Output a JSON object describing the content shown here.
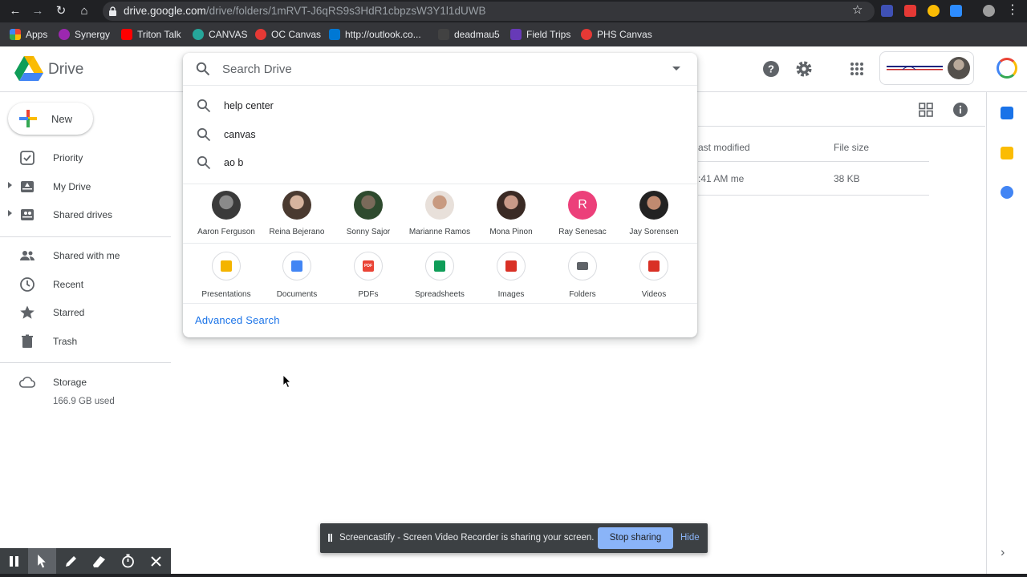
{
  "browser": {
    "url_host": "drive.google.com",
    "url_path": "/drive/folders/1mRVT-J6qRS9s3HdR1cbpzsW3Y1l1dUWB",
    "bookmarks": [
      {
        "label": "Apps",
        "color": "#ea4335"
      },
      {
        "label": "Synergy",
        "color": "#9c27b0"
      },
      {
        "label": "Triton Talk",
        "color": "#ff0000"
      },
      {
        "label": "CANVAS",
        "color": "#26a69a"
      },
      {
        "label": "OC Canvas",
        "color": "#e53935"
      },
      {
        "label": "http://outlook.co...",
        "color": "#0078d4"
      },
      {
        "label": "deadmau5",
        "color": "#424242"
      },
      {
        "label": "Field Trips",
        "color": "#673ab7"
      },
      {
        "label": "PHS Canvas",
        "color": "#e53935"
      }
    ]
  },
  "drive": {
    "title": "Drive",
    "new_label": "New",
    "nav": [
      {
        "label": "Priority"
      },
      {
        "label": "My Drive"
      },
      {
        "label": "Shared drives"
      },
      {
        "label": "Shared with me"
      },
      {
        "label": "Recent"
      },
      {
        "label": "Starred"
      },
      {
        "label": "Trash"
      }
    ],
    "storage_label": "Storage",
    "storage_used": "166.9 GB used"
  },
  "search": {
    "placeholder": "Search Drive",
    "suggestions": [
      "help center",
      "canvas",
      "ao b"
    ],
    "people": [
      {
        "name": "Aaron Ferguson"
      },
      {
        "name": "Reina Bejerano"
      },
      {
        "name": "Sonny Sajor"
      },
      {
        "name": "Marianne Ramos"
      },
      {
        "name": "Mona Pinon"
      },
      {
        "name": "Ray Senesac",
        "initial": "R"
      },
      {
        "name": "Jay Sorensen"
      }
    ],
    "file_types": [
      {
        "label": "Presentations",
        "color": "#f4b400"
      },
      {
        "label": "Documents",
        "color": "#4285f4"
      },
      {
        "label": "PDFs",
        "color": "#ea4335",
        "glyph": "PDF"
      },
      {
        "label": "Spreadsheets",
        "color": "#0f9d58"
      },
      {
        "label": "Images",
        "color": "#d93025"
      },
      {
        "label": "Folders",
        "color": "#5f6368"
      },
      {
        "label": "Videos",
        "color": "#d93025"
      }
    ],
    "advanced_label": "Advanced Search"
  },
  "file_list": {
    "col_last_modified": "ast modified",
    "col_file_size": "File size",
    "row_modified": ":41 AM  me",
    "row_size": "38 KB"
  },
  "share_notice": {
    "message": "Screencastify - Screen Video Recorder is sharing your screen.",
    "stop_label": "Stop sharing",
    "hide_label": "Hide"
  }
}
